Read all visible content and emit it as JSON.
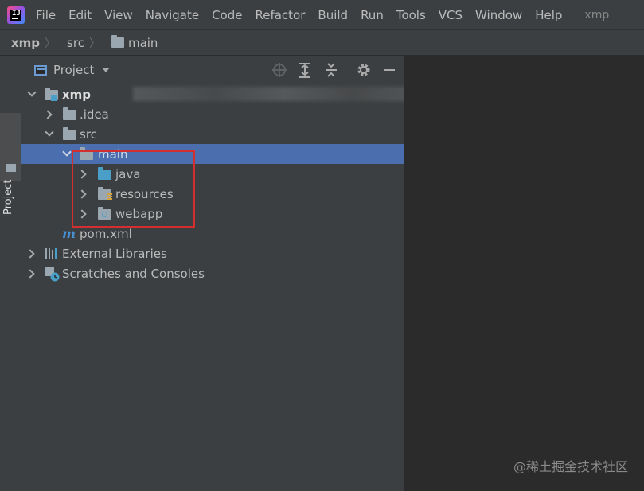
{
  "menubar": {
    "items": [
      "File",
      "Edit",
      "View",
      "Navigate",
      "Code",
      "Refactor",
      "Build",
      "Run",
      "Tools",
      "VCS",
      "Window",
      "Help"
    ],
    "window_title": "xmp"
  },
  "breadcrumb": {
    "items": [
      "xmp",
      "src",
      "main"
    ]
  },
  "sidebar_strip": {
    "label": "Project"
  },
  "panel": {
    "title": "Project",
    "tree": {
      "root": "xmp",
      "idea": ".idea",
      "src": "src",
      "main": "main",
      "java": "java",
      "resources": "resources",
      "webapp": "webapp",
      "pom": "pom.xml",
      "external": "External Libraries",
      "scratches": "Scratches and Consoles"
    }
  },
  "watermark": "@稀土掘金技术社区",
  "colors": {
    "selection": "#4b6eaf",
    "highlight_box": "#d32f2f",
    "folder": "#9aa7b0",
    "source_folder": "#4a9fc8",
    "maven": "#4a8fd1"
  }
}
